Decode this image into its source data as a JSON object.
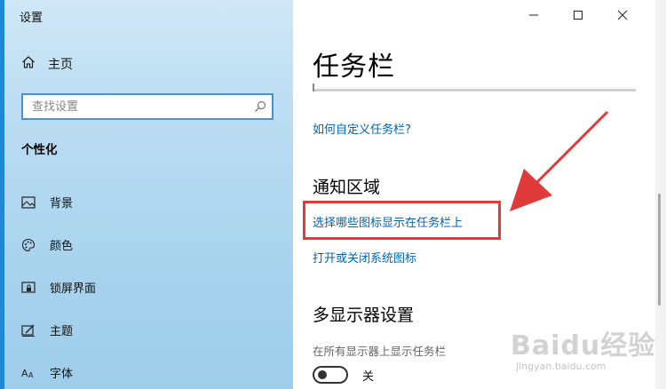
{
  "window": {
    "title": "设置"
  },
  "sidebar": {
    "home_label": "主页",
    "search_placeholder": "查找设置",
    "section_title": "个性化",
    "items": [
      {
        "label": "背景",
        "icon": "image-icon"
      },
      {
        "label": "颜色",
        "icon": "palette-icon"
      },
      {
        "label": "锁屏界面",
        "icon": "lock-screen-icon"
      },
      {
        "label": "主题",
        "icon": "theme-icon"
      },
      {
        "label": "字体",
        "icon": "font-icon"
      }
    ]
  },
  "main": {
    "page_title": "任务栏",
    "customize_link": "如何自定义任务栏?",
    "notification_heading": "通知区域",
    "select_icons_link": "选择哪些图标显示在任务栏上",
    "system_icons_link": "打开或关闭系统图标",
    "multi_display_heading": "多显示器设置",
    "show_all_displays_label": "在所有显示器上显示任务栏",
    "toggle_state_label": "关",
    "toggle_on": false
  },
  "annotation": {
    "highlight_color": "#e03a3a"
  },
  "watermark": {
    "brand": "Baidu经验",
    "url": "jingyan.baidu.com"
  },
  "colors": {
    "accent": "#0063b1",
    "sidebar_gradient_top": "#cfe7f7",
    "sidebar_gradient_bottom": "#9ecdea"
  }
}
